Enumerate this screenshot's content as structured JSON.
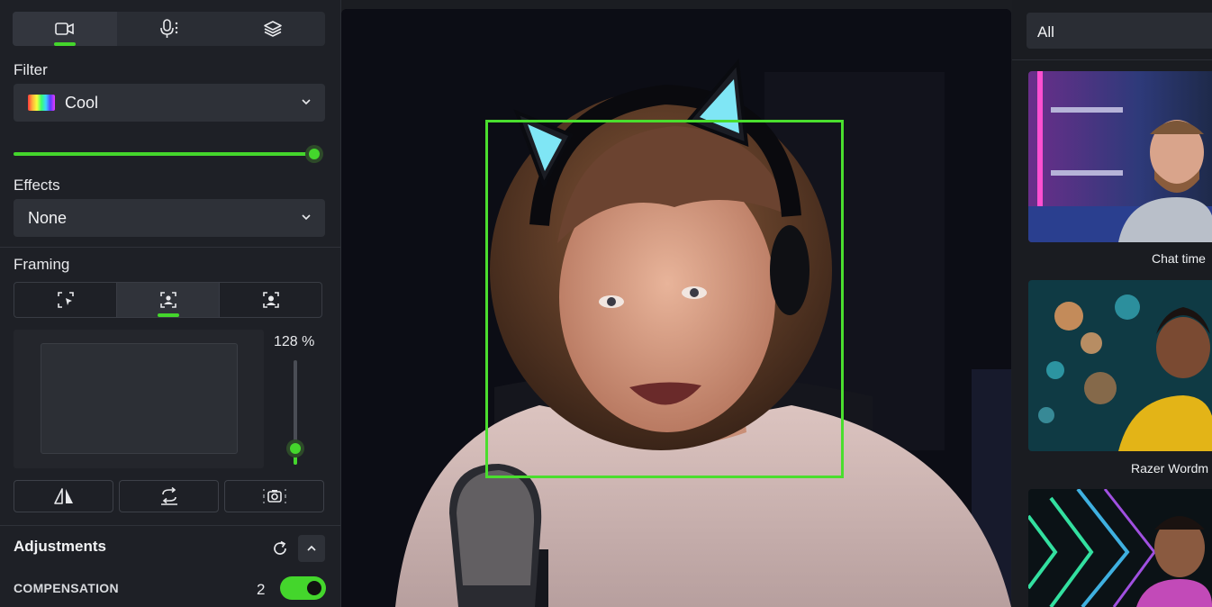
{
  "colors": {
    "accent": "#44d62c",
    "frame": "#4ade2e",
    "panel": "#1e2026",
    "control": "#2e3138"
  },
  "top_tabs": [
    {
      "icon": "video-camera-icon",
      "active": true
    },
    {
      "icon": "microphone-icon",
      "active": false
    },
    {
      "icon": "layers-icon",
      "active": false
    }
  ],
  "filter": {
    "label": "Filter",
    "selected": "Cool",
    "swatch_icon": "color-swatch-icon",
    "intensity_fraction": 1.0
  },
  "effects": {
    "label": "Effects",
    "selected": "None"
  },
  "framing": {
    "label": "Framing",
    "modes": [
      {
        "icon": "manual-select-icon",
        "active": false
      },
      {
        "icon": "face-track-icon",
        "active": true
      },
      {
        "icon": "face-frame-icon",
        "active": false
      }
    ],
    "zoom_label": "128 %",
    "zoom_fraction": 0.1,
    "tools": [
      "mirror-icon",
      "rotate-icon",
      "snapshot-icon"
    ]
  },
  "adjustments": {
    "title": "Adjustments",
    "compensation_label": "COMPENSATION",
    "compensation_value": "2",
    "compensation_on": true
  },
  "right_panel": {
    "category": "All",
    "backgrounds": [
      {
        "label": "Chat time"
      },
      {
        "label": "Razer Wordm"
      },
      {
        "label": ""
      }
    ]
  }
}
